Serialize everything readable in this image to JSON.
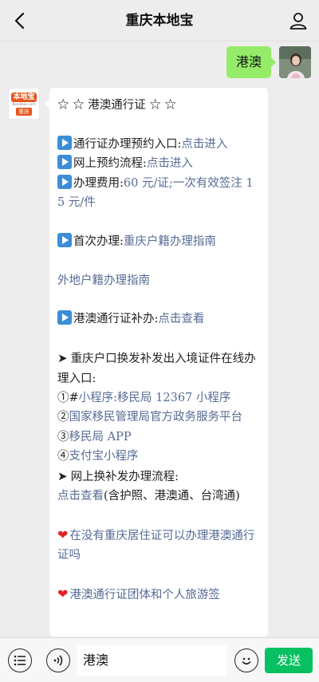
{
  "navbar": {
    "title": "重庆本地宝"
  },
  "chat": {
    "outgoing_message": "港澳",
    "bot_avatar": {
      "brand": "本地宝",
      "url": "Bendibao.com",
      "city": "重庆"
    },
    "reply": {
      "title": "☆ ☆ 港澳通行证 ☆ ☆",
      "item1_label": "通行证办理预约入口:",
      "item1_link": "点击进入",
      "item2_label": "网上预约流程:",
      "item2_link": "点击进入",
      "item3_label": "办理费用:",
      "item3_value": "60 元/证;一次有效签注 15 元/件",
      "item4_label": "首次办理:",
      "item4_link": "重庆户籍办理指南",
      "item5_link": "外地户籍办理指南",
      "item6_label": "港澳通行证补办:",
      "item6_link": "点击查看",
      "section2_heading": "重庆户口换发补发出入境证件在线办理入口:",
      "entry1_prefix": "①#",
      "entry1_text": "小程序:移民局 12367 小程序",
      "entry2_prefix": "②",
      "entry2_text": "国家移民管理局官方政务服务平台",
      "entry3_prefix": "③",
      "entry3_text": "移民局 APP",
      "entry4_prefix": "④",
      "entry4_text": "支付宝小程序",
      "section3_heading": "网上换补发办理流程:",
      "section3_link": "点击查看",
      "section3_note": "(含护照、港澳通、台湾通)",
      "heart1_link": "在没有重庆居住证可以办理港澳通行证吗",
      "heart2_link": "港澳通行证团体和个人旅游签"
    }
  },
  "inputbar": {
    "text": "港澳",
    "send_label": "发送"
  }
}
